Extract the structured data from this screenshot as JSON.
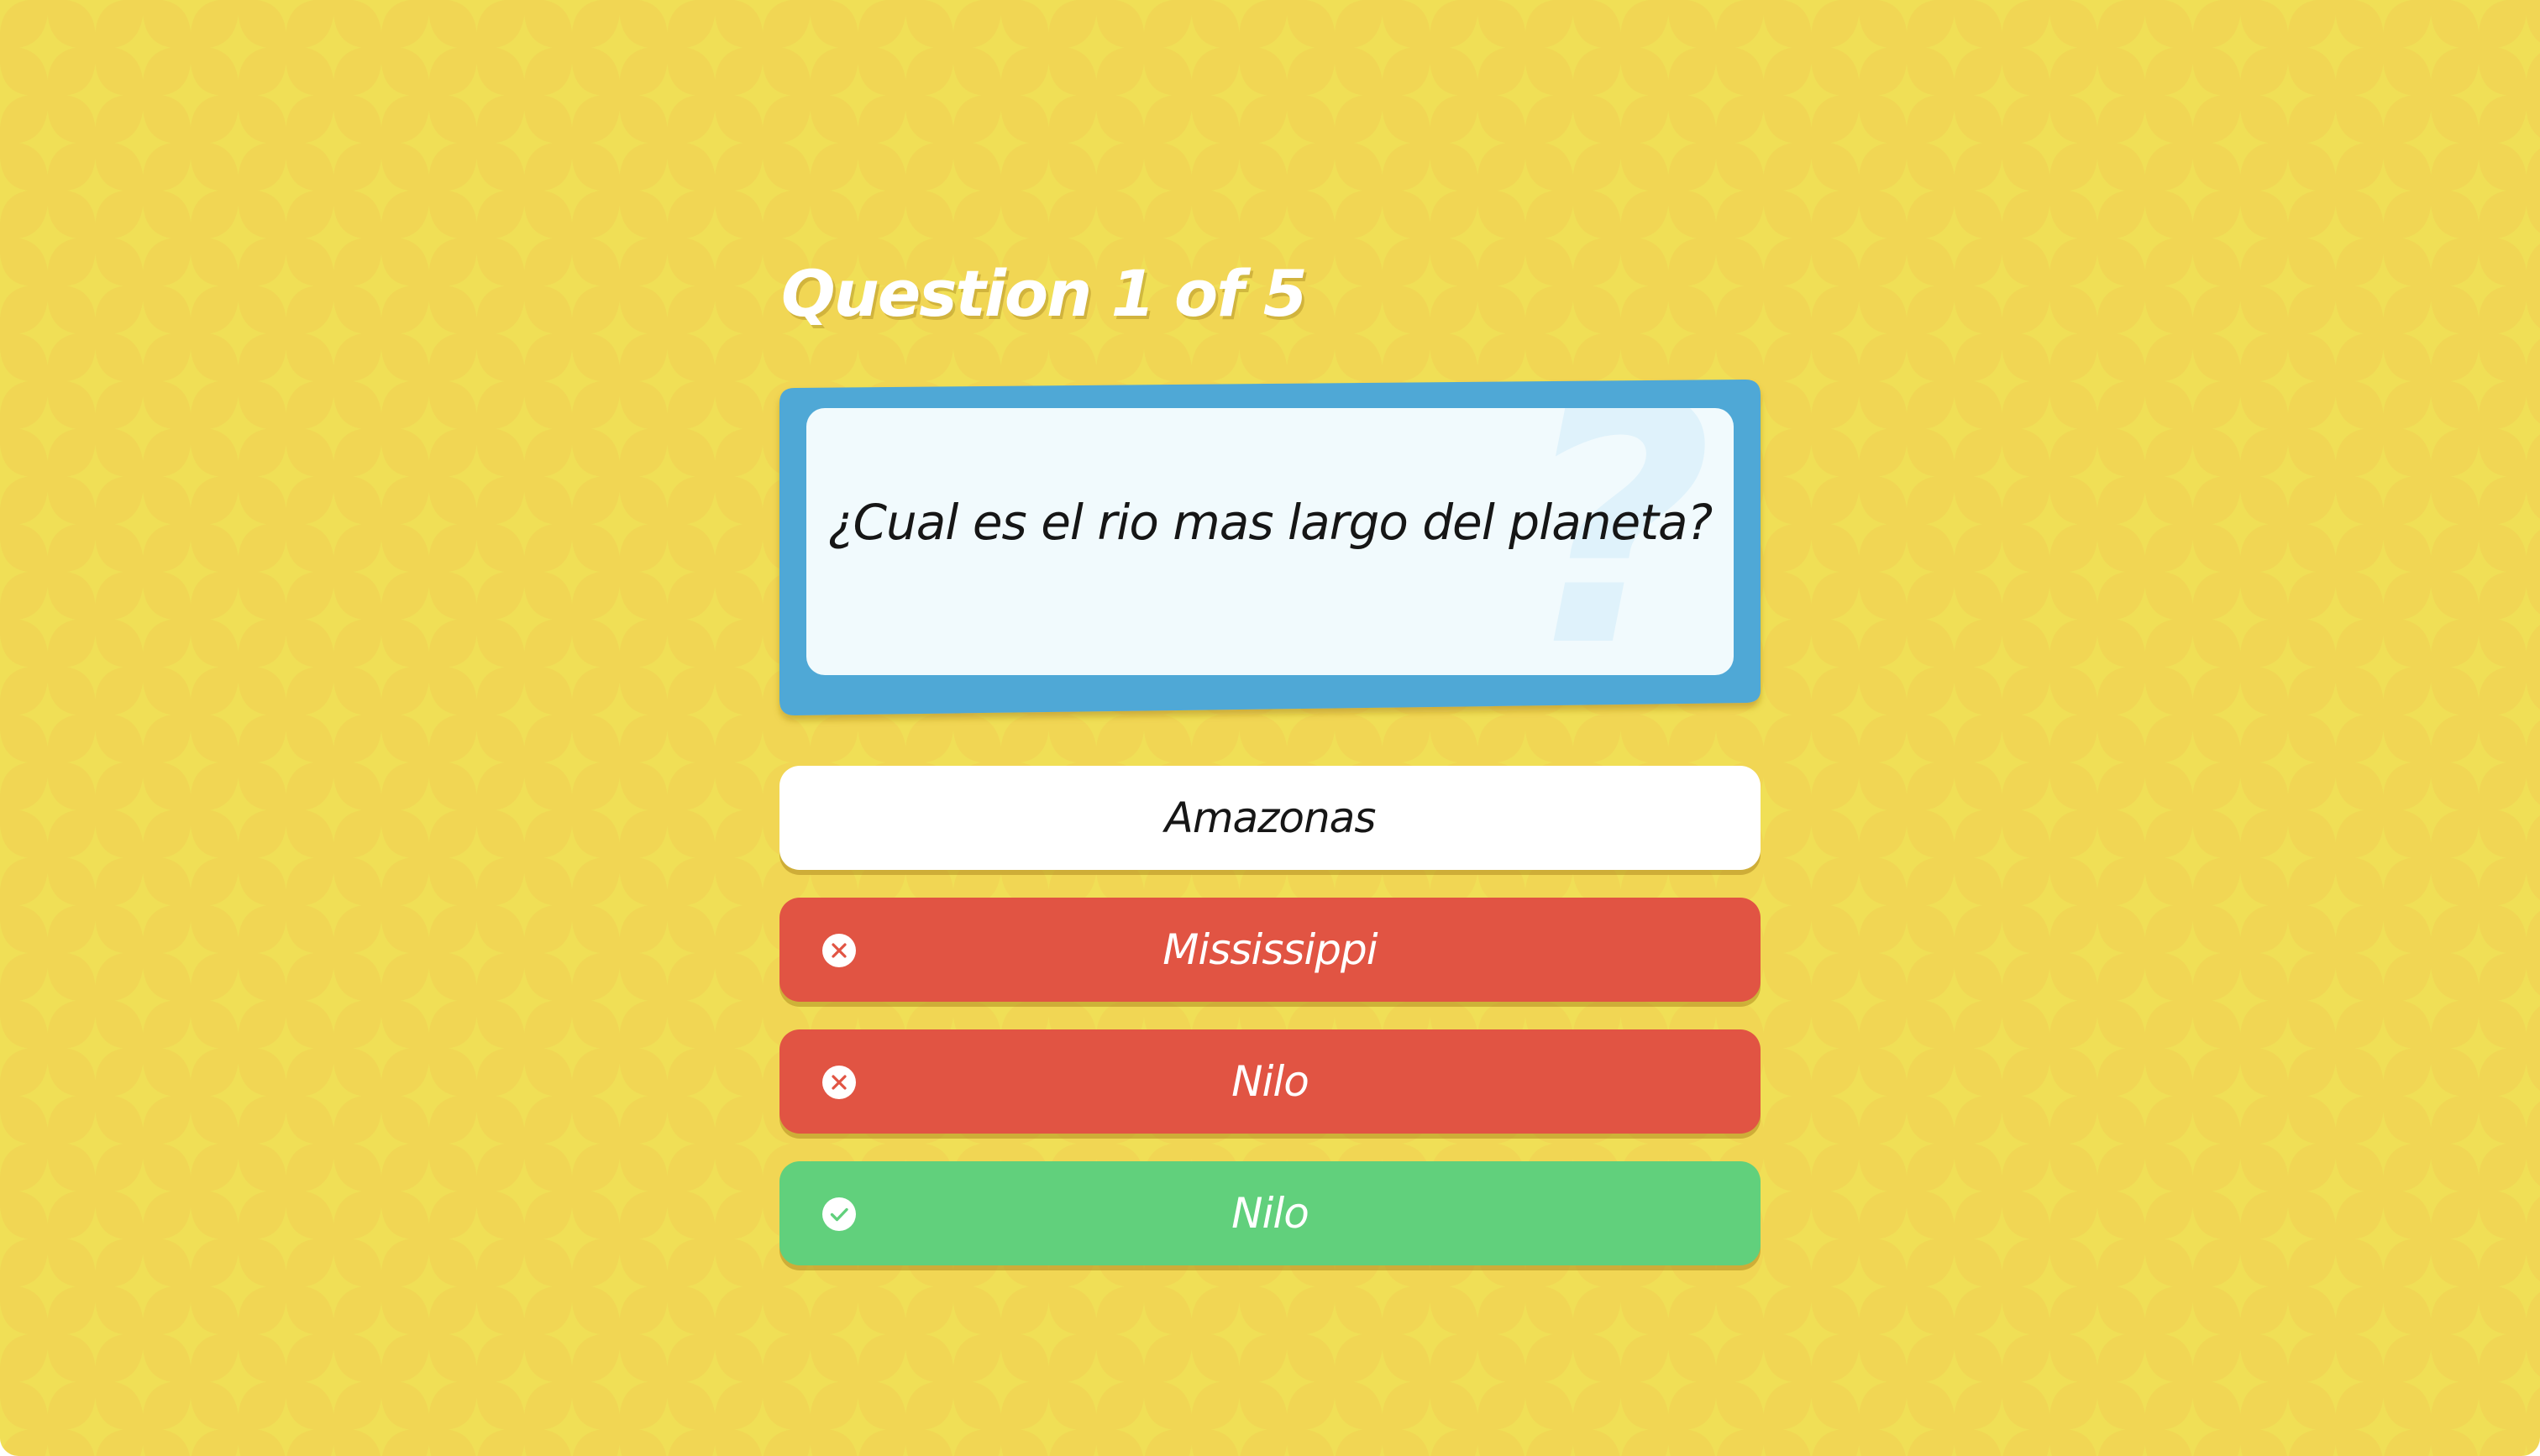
{
  "quiz": {
    "counter": "Question 1 of 5",
    "question": "¿Cual es el rio mas largo del planeta?",
    "decor_glyph": "?",
    "answers": [
      {
        "label": "Amazonas",
        "state": "default",
        "icon": ""
      },
      {
        "label": "Mississippi",
        "state": "wrong",
        "icon": "close-circle-icon"
      },
      {
        "label": "Nilo",
        "state": "wrong",
        "icon": "close-circle-icon"
      },
      {
        "label": "Nilo",
        "state": "correct",
        "icon": "check-circle-icon"
      }
    ]
  },
  "colors": {
    "background": "#f1d654",
    "pattern": "#f0df56",
    "card_frame": "#4fa8d6",
    "card_face": "#f1fafd",
    "answer_default": "#ffffff",
    "answer_wrong": "#e15443",
    "answer_correct": "#61d07c"
  }
}
